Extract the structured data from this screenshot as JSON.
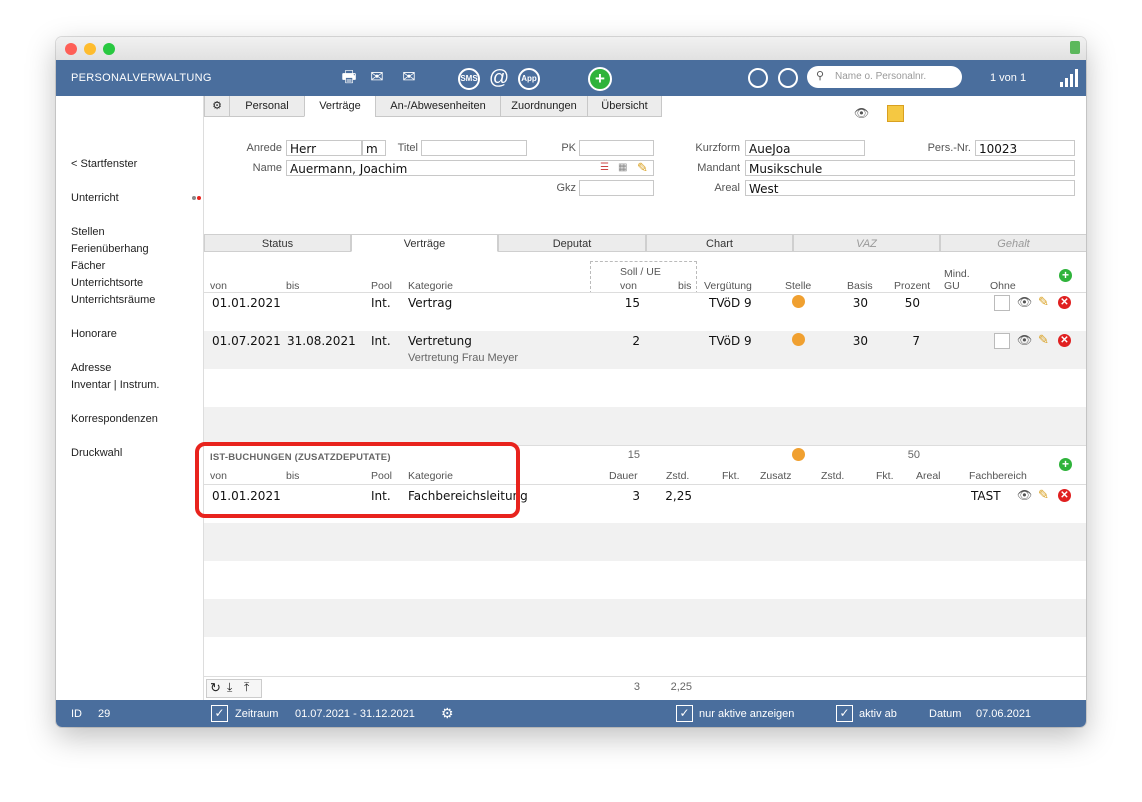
{
  "app": {
    "title": "PERSONALVERWALTUNG",
    "pager": "1 von 1"
  },
  "search": {
    "placeholder": "Name o. Personalnr."
  },
  "toolbar_icons": [
    "printer-icon",
    "mail-icon",
    "mail-multi-icon",
    "sms-icon",
    "at-icon",
    "app-icon",
    "add-icon",
    "refresh-icon",
    "search-icon",
    "signal-icon"
  ],
  "sidebar": {
    "back": "< Startfenster",
    "items": [
      "Unterricht",
      "Stellen",
      "Ferienüberhang",
      "Fächer",
      "Unterrichtsorte",
      "Unterrichtsräume",
      "Honorare",
      "Adresse",
      "Inventar | Instrum.",
      "Korrespondenzen",
      "Druckwahl"
    ]
  },
  "tabs": [
    "Personal",
    "Verträge",
    "An-/Abwesenheiten",
    "Zuordnungen",
    "Übersicht"
  ],
  "form": {
    "anrede_label": "Anrede",
    "anrede": "Herr",
    "gender": "m",
    "titel_label": "Titel",
    "titel": "",
    "pk_label": "PK",
    "pk": "",
    "name_label": "Name",
    "name": "Auermann, Joachim",
    "gkz_label": "Gkz",
    "gkz": "",
    "kurzform_label": "Kurzform",
    "kurzform": "AueJoa",
    "persnr_label": "Pers.-Nr.",
    "persnr": "10023",
    "mandant_label": "Mandant",
    "mandant": "Musikschule",
    "areal_label": "Areal",
    "areal": "West"
  },
  "subtabs": [
    "Status",
    "Verträge",
    "Deputat",
    "Chart",
    "VAZ",
    "Gehalt"
  ],
  "contracts": {
    "headers": {
      "von": "von",
      "bis": "bis",
      "pool": "Pool",
      "kategorie": "Kategorie",
      "soll_ue": "Soll / UE",
      "soll_von": "von",
      "soll_bis": "bis",
      "verguetung": "Vergütung",
      "stelle": "Stelle",
      "basis": "Basis",
      "prozent": "Prozent",
      "mind_gu_1": "Mind.",
      "mind_gu_2": "GU",
      "ohne": "Ohne"
    },
    "rows": [
      {
        "von": "01.01.2021",
        "bis": "",
        "pool": "Int.",
        "kategorie": "Vertrag",
        "sub": "",
        "soll": "15",
        "verguetung": "TVöD 9",
        "basis": "30",
        "prozent": "50"
      },
      {
        "von": "01.07.2021",
        "bis": "31.08.2021",
        "pool": "Int.",
        "kategorie": "Vertretung",
        "sub": "Vertretung Frau Meyer",
        "soll": "2",
        "verguetung": "TVöD 9",
        "basis": "30",
        "prozent": "7"
      }
    ],
    "totals": {
      "soll": "15",
      "prozent": "50"
    }
  },
  "ist": {
    "title": "IST-BUCHUNGEN (ZUSATZDEPUTATE)",
    "headers": {
      "von": "von",
      "bis": "bis",
      "pool": "Pool",
      "kategorie": "Kategorie",
      "dauer": "Dauer",
      "zstd": "Zstd.",
      "fkt": "Fkt.",
      "zusatz": "Zusatz",
      "zstd2": "Zstd.",
      "fkt2": "Fkt.",
      "areal": "Areal",
      "fachbereich": "Fachbereich"
    },
    "rows": [
      {
        "von": "01.01.2021",
        "pool": "Int.",
        "kategorie": "Fachbereichsleitung",
        "dauer": "3",
        "zstd": "2,25",
        "fachbereich": "TAST"
      }
    ],
    "totals": {
      "dauer": "3",
      "zstd": "2,25"
    }
  },
  "footer": {
    "id_label": "ID",
    "id": "29",
    "zeitraum_label": "Zeitraum",
    "zeitraum": "01.07.2021  -  31.12.2021",
    "nur_aktive": "nur aktive anzeigen",
    "aktiv_ab": "aktiv ab",
    "datum_label": "Datum",
    "datum": "07.06.2021"
  },
  "colors": {
    "toolbar": "#4a6e9d",
    "highlight": "#e8231d",
    "orange": "#f0a030",
    "green": "#2fb33b"
  }
}
